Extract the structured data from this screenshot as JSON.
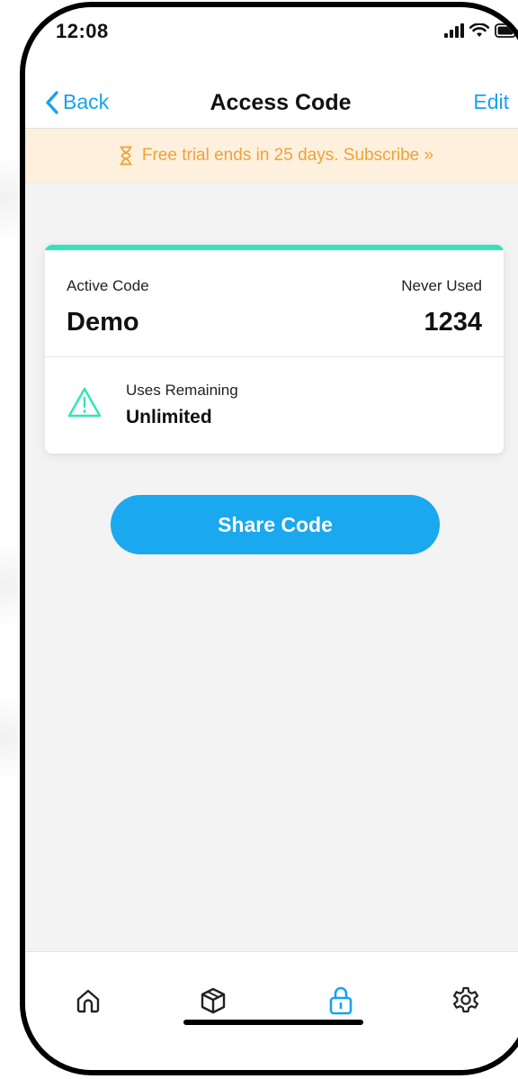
{
  "status_bar": {
    "time": "12:08",
    "icons": [
      "cellular-signal-icon",
      "wifi-icon",
      "battery-icon"
    ]
  },
  "nav": {
    "back_label": "Back",
    "title": "Access Code",
    "edit_label": "Edit"
  },
  "trial_banner": {
    "icon": "hourglass-icon",
    "text": "Free trial ends in 25 days. Subscribe »"
  },
  "code_card": {
    "active_label": "Active Code",
    "active_value": "Demo",
    "usage_label": "Never Used",
    "code_value": "1234",
    "warning_icon": "warning-triangle-icon",
    "uses_label": "Uses Remaining",
    "uses_value": "Unlimited"
  },
  "share_button_label": "Share Code",
  "tabs": [
    {
      "icon": "home-icon",
      "active": false
    },
    {
      "icon": "package-box-icon",
      "active": false
    },
    {
      "icon": "lock-icon",
      "active": true
    },
    {
      "icon": "gear-icon",
      "active": false
    }
  ],
  "colors": {
    "accent": "#17a3ee",
    "card_accent": "#2ee6b4",
    "banner_bg": "#fdf0dc",
    "banner_text": "#f0a23a",
    "button_bg": "#1aa8ee",
    "background": "#f3f3f3"
  }
}
